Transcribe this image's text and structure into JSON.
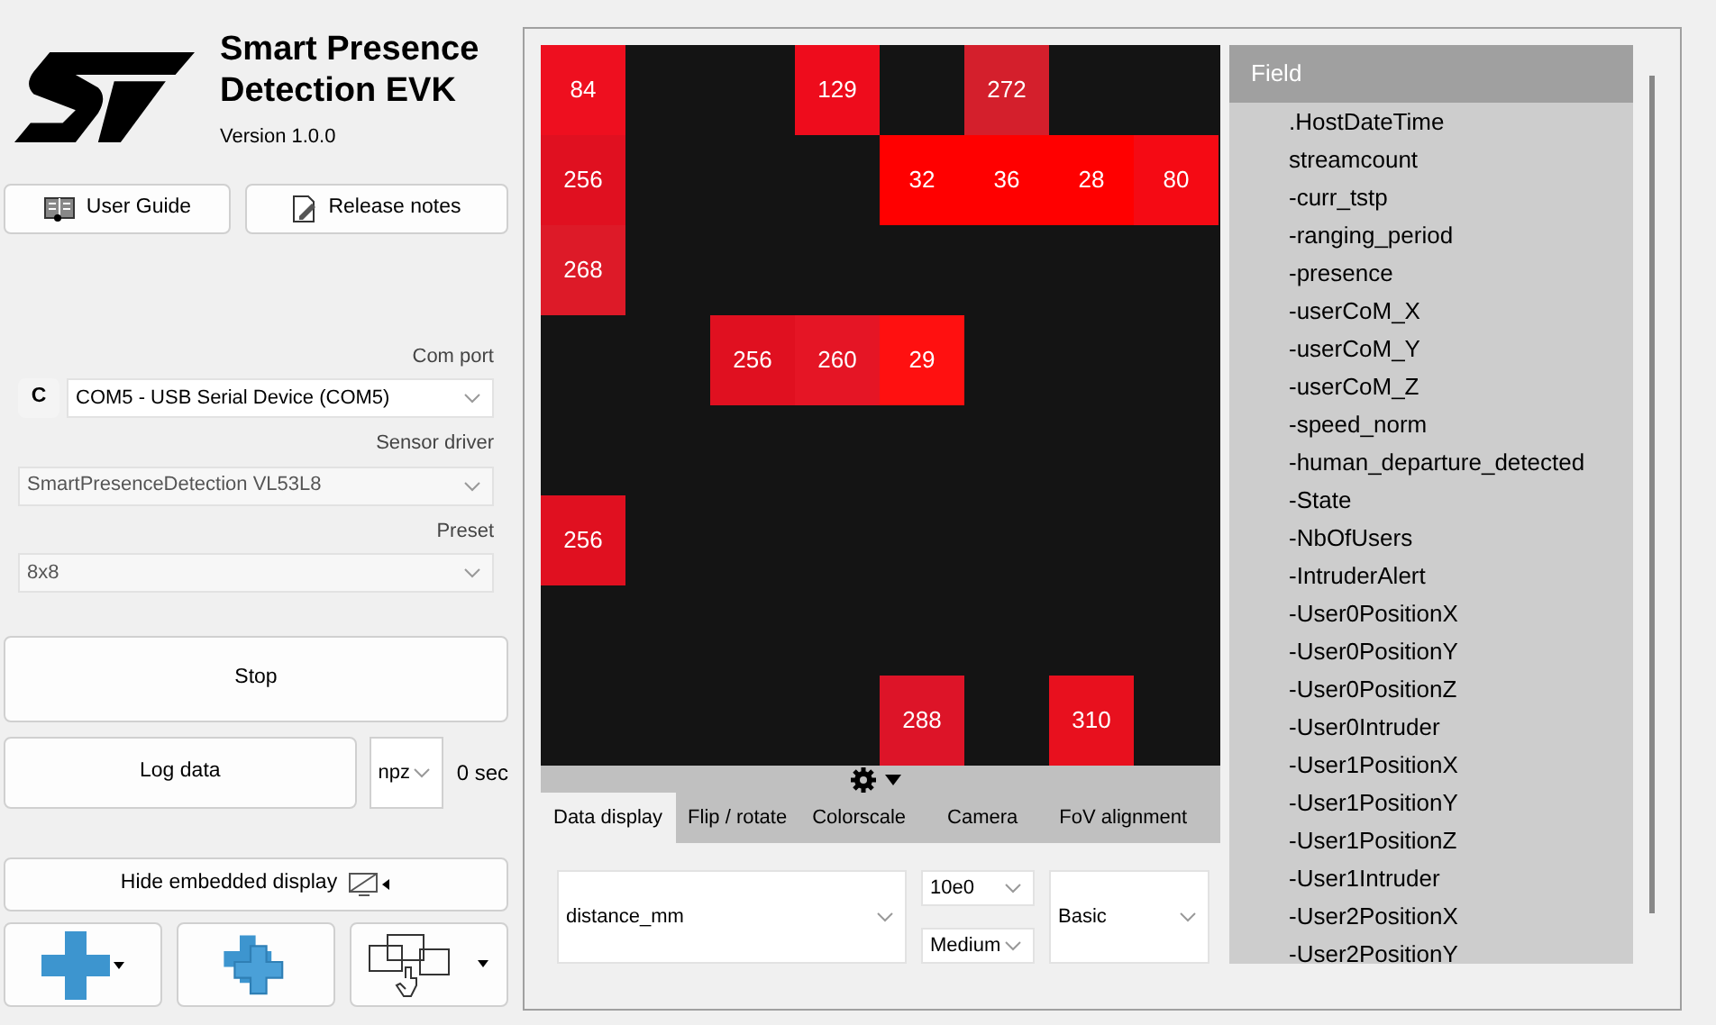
{
  "app": {
    "title": "Smart Presence Detection EVK",
    "version": "Version 1.0.0"
  },
  "doc_buttons": [
    {
      "label": "User Guide",
      "kind": "guide"
    },
    {
      "label": "Release notes",
      "kind": "notes"
    }
  ],
  "com_port": {
    "label": "Com port",
    "refresh": "C",
    "value": "COM5 - USB Serial Device (COM5)"
  },
  "sensor_driver": {
    "label": "Sensor driver",
    "value": "SmartPresenceDetection VL53L8",
    "disabled": true
  },
  "preset": {
    "label": "Preset",
    "value": "8x8",
    "disabled": true
  },
  "stop_button": "Stop",
  "log": {
    "button": "Log data",
    "format": "npz",
    "duration": "0 sec"
  },
  "hide_display_button": "Hide embedded display",
  "heatmap": [
    [
      {
        "kind": "value",
        "value": "84",
        "color": "#ee0f1f"
      },
      {
        "kind": "empty"
      },
      {
        "kind": "empty"
      },
      {
        "kind": "value",
        "value": "129",
        "color": "#ee0c1c"
      },
      {
        "kind": "empty"
      },
      {
        "kind": "value",
        "value": "272",
        "color": "#d41f2c"
      },
      {
        "kind": "empty"
      },
      {
        "kind": "empty"
      }
    ],
    [
      {
        "kind": "value",
        "value": "256",
        "color": "#e01020"
      },
      {
        "kind": "empty"
      },
      {
        "kind": "empty"
      },
      {
        "kind": "empty"
      },
      {
        "kind": "value",
        "value": "32",
        "color": "#ff0000"
      },
      {
        "kind": "value",
        "value": "36",
        "color": "#ff0000"
      },
      {
        "kind": "value",
        "value": "28",
        "color": "#ff0000"
      },
      {
        "kind": "value",
        "value": "80",
        "color": "#f50a14"
      }
    ],
    [
      {
        "kind": "value",
        "value": "268",
        "color": "#dd1a28"
      },
      {
        "kind": "empty"
      },
      {
        "kind": "empty"
      },
      {
        "kind": "empty"
      },
      {
        "kind": "empty"
      },
      {
        "kind": "empty"
      },
      {
        "kind": "empty"
      },
      {
        "kind": "empty"
      }
    ],
    [
      {
        "kind": "empty"
      },
      {
        "kind": "empty"
      },
      {
        "kind": "value",
        "value": "256",
        "color": "#e01020"
      },
      {
        "kind": "value",
        "value": "260",
        "color": "#e51525"
      },
      {
        "kind": "value",
        "value": "29",
        "color": "#ff1010"
      },
      {
        "kind": "empty"
      },
      {
        "kind": "empty"
      },
      {
        "kind": "empty"
      }
    ],
    [
      {
        "kind": "empty"
      },
      {
        "kind": "empty"
      },
      {
        "kind": "empty"
      },
      {
        "kind": "empty"
      },
      {
        "kind": "empty"
      },
      {
        "kind": "empty"
      },
      {
        "kind": "empty"
      },
      {
        "kind": "empty"
      }
    ],
    [
      {
        "kind": "value",
        "value": "256",
        "color": "#e01020"
      },
      {
        "kind": "empty"
      },
      {
        "kind": "empty"
      },
      {
        "kind": "empty"
      },
      {
        "kind": "empty"
      },
      {
        "kind": "empty"
      },
      {
        "kind": "empty"
      },
      {
        "kind": "empty"
      }
    ],
    [
      {
        "kind": "empty"
      },
      {
        "kind": "empty"
      },
      {
        "kind": "empty"
      },
      {
        "kind": "empty"
      },
      {
        "kind": "empty"
      },
      {
        "kind": "empty"
      },
      {
        "kind": "empty"
      },
      {
        "kind": "empty"
      }
    ],
    [
      {
        "kind": "empty"
      },
      {
        "kind": "empty"
      },
      {
        "kind": "empty"
      },
      {
        "kind": "empty"
      },
      {
        "kind": "value",
        "value": "288",
        "color": "#dd1428"
      },
      {
        "kind": "empty"
      },
      {
        "kind": "value",
        "value": "310",
        "color": "#e8101e"
      },
      {
        "kind": "empty"
      }
    ]
  ],
  "tabs": [
    {
      "label": "Data display",
      "selected": true
    },
    {
      "label": "Flip / rotate",
      "selected": false
    },
    {
      "label": "Colorscale",
      "selected": false
    },
    {
      "label": "Camera",
      "selected": false
    },
    {
      "label": "FoV alignment",
      "selected": false
    }
  ],
  "display_controls": {
    "field": "distance_mm",
    "scale": "10e0",
    "level": "Medium",
    "mode": "Basic"
  },
  "field_list": {
    "header": "Field",
    "items": [
      ".HostDateTime",
      "streamcount",
      "-curr_tstp",
      "-ranging_period",
      "-presence",
      "-userCoM_X",
      "-userCoM_Y",
      "-userCoM_Z",
      "-speed_norm",
      "-human_departure_detected",
      "-State",
      "-NbOfUsers",
      "-IntruderAlert",
      "-User0PositionX",
      "-User0PositionY",
      "-User0PositionZ",
      "-User0Intruder",
      "-User1PositionX",
      "-User1PositionY",
      "-User1PositionZ",
      "-User1Intruder",
      "-User2PositionX",
      "-User2PositionY"
    ]
  }
}
